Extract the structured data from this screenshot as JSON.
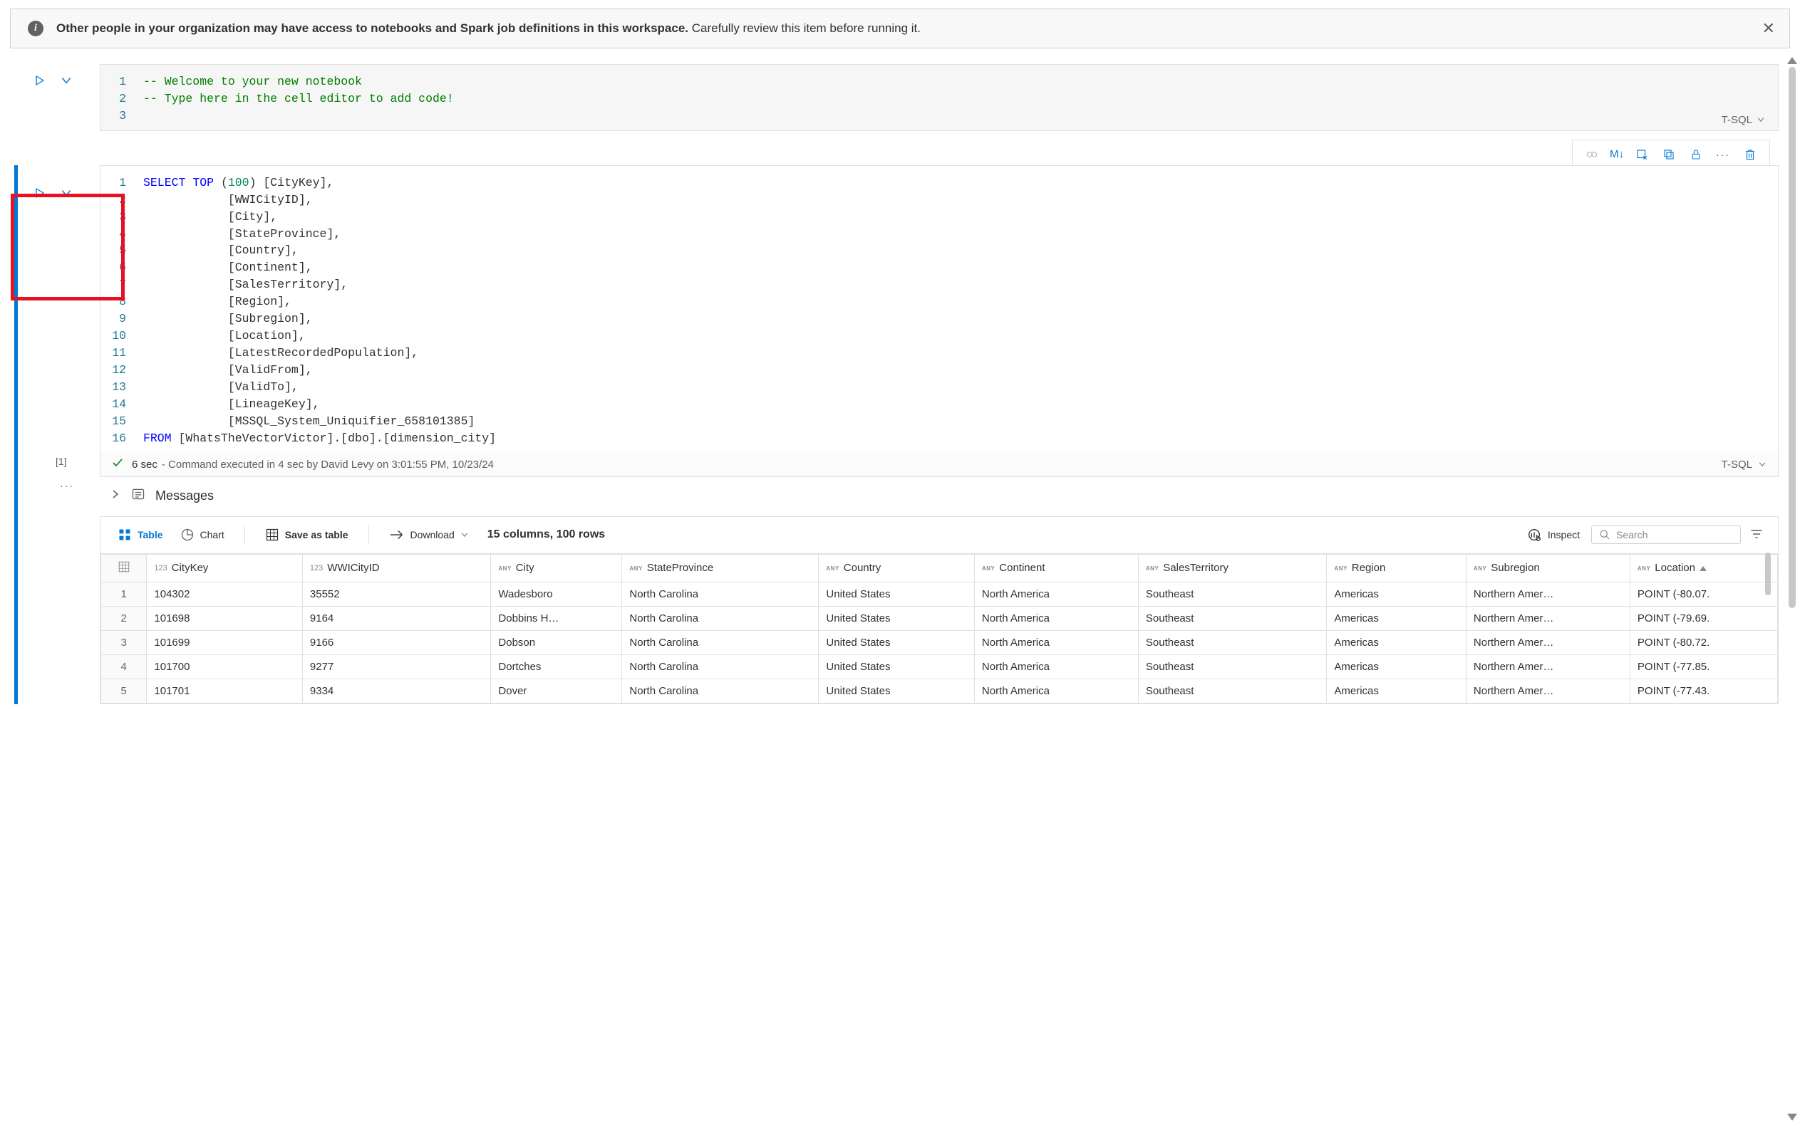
{
  "banner": {
    "bold": "Other people in your organization may have access to notebooks and Spark job definitions in this workspace.",
    "rest": " Carefully review this item before running it."
  },
  "cell1": {
    "lang": "T-SQL",
    "lines": [
      {
        "n": "1",
        "tokens": [
          {
            "t": "-- Welcome to your new notebook",
            "c": "tok-cmt"
          }
        ]
      },
      {
        "n": "2",
        "tokens": [
          {
            "t": "-- Type here in the cell editor to add code!",
            "c": "tok-cmt"
          }
        ]
      },
      {
        "n": "3",
        "tokens": [
          {
            "t": ""
          }
        ]
      }
    ]
  },
  "cell2": {
    "lang": "T-SQL",
    "idx_label": "[1]",
    "lines": [
      {
        "n": "1",
        "tokens": [
          {
            "t": "SELECT",
            "c": "tok-kw"
          },
          {
            "t": " "
          },
          {
            "t": "TOP",
            "c": "tok-kw"
          },
          {
            "t": " ("
          },
          {
            "t": "100",
            "c": "tok-num"
          },
          {
            "t": ") [CityKey],"
          }
        ]
      },
      {
        "n": "2",
        "tokens": [
          {
            "t": "            [WWICityID],"
          }
        ]
      },
      {
        "n": "3",
        "tokens": [
          {
            "t": "            [City],"
          }
        ]
      },
      {
        "n": "4",
        "tokens": [
          {
            "t": "            [StateProvince],"
          }
        ]
      },
      {
        "n": "5",
        "tokens": [
          {
            "t": "            [Country],"
          }
        ]
      },
      {
        "n": "6",
        "tokens": [
          {
            "t": "            [Continent],"
          }
        ]
      },
      {
        "n": "7",
        "tokens": [
          {
            "t": "            [SalesTerritory],"
          }
        ]
      },
      {
        "n": "8",
        "tokens": [
          {
            "t": "            [Region],"
          }
        ]
      },
      {
        "n": "9",
        "tokens": [
          {
            "t": "            [Subregion],"
          }
        ]
      },
      {
        "n": "10",
        "tokens": [
          {
            "t": "            [Location],"
          }
        ]
      },
      {
        "n": "11",
        "tokens": [
          {
            "t": "            [LatestRecordedPopulation],"
          }
        ]
      },
      {
        "n": "12",
        "tokens": [
          {
            "t": "            [ValidFrom],"
          }
        ]
      },
      {
        "n": "13",
        "tokens": [
          {
            "t": "            [ValidTo],"
          }
        ]
      },
      {
        "n": "14",
        "tokens": [
          {
            "t": "            [LineageKey],"
          }
        ]
      },
      {
        "n": "15",
        "tokens": [
          {
            "t": "            [MSSQL_System_Uniquifier_658101385]"
          }
        ]
      },
      {
        "n": "16",
        "tokens": [
          {
            "t": "FROM",
            "c": "tok-kw"
          },
          {
            "t": " [WhatsTheVectorVictor].[dbo].[dimension_city]"
          }
        ]
      }
    ],
    "status": {
      "duration": "6 sec",
      "detail": "- Command executed in 4 sec by David Levy on 3:01:55 PM, 10/23/24"
    },
    "toolbar_md": "M↓"
  },
  "messages_label": "Messages",
  "results": {
    "table_label": "Table",
    "chart_label": "Chart",
    "save_label": "Save as table",
    "download_label": "Download",
    "summary": "15 columns, 100 rows",
    "inspect_label": "Inspect",
    "search_placeholder": "Search",
    "columns": [
      {
        "type": "idx",
        "name": ""
      },
      {
        "type": "123",
        "name": "CityKey"
      },
      {
        "type": "123",
        "name": "WWICityID"
      },
      {
        "type": "ANY",
        "name": "City"
      },
      {
        "type": "ANY",
        "name": "StateProvince"
      },
      {
        "type": "ANY",
        "name": "Country"
      },
      {
        "type": "ANY",
        "name": "Continent"
      },
      {
        "type": "ANY",
        "name": "SalesTerritory"
      },
      {
        "type": "ANY",
        "name": "Region"
      },
      {
        "type": "ANY",
        "name": "Subregion"
      },
      {
        "type": "ANY",
        "name": "Location"
      }
    ],
    "rows": [
      {
        "n": "1",
        "CityKey": "104302",
        "WWICityID": "35552",
        "City": "Wadesboro",
        "StateProvince": "North Carolina",
        "Country": "United States",
        "Continent": "North America",
        "SalesTerritory": "Southeast",
        "Region": "Americas",
        "Subregion": "Northern Amer…",
        "Location": "POINT (-80.07."
      },
      {
        "n": "2",
        "CityKey": "101698",
        "WWICityID": "9164",
        "City": "Dobbins H…",
        "StateProvince": "North Carolina",
        "Country": "United States",
        "Continent": "North America",
        "SalesTerritory": "Southeast",
        "Region": "Americas",
        "Subregion": "Northern Amer…",
        "Location": "POINT (-79.69."
      },
      {
        "n": "3",
        "CityKey": "101699",
        "WWICityID": "9166",
        "City": "Dobson",
        "StateProvince": "North Carolina",
        "Country": "United States",
        "Continent": "North America",
        "SalesTerritory": "Southeast",
        "Region": "Americas",
        "Subregion": "Northern Amer…",
        "Location": "POINT (-80.72."
      },
      {
        "n": "4",
        "CityKey": "101700",
        "WWICityID": "9277",
        "City": "Dortches",
        "StateProvince": "North Carolina",
        "Country": "United States",
        "Continent": "North America",
        "SalesTerritory": "Southeast",
        "Region": "Americas",
        "Subregion": "Northern Amer…",
        "Location": "POINT (-77.85."
      },
      {
        "n": "5",
        "CityKey": "101701",
        "WWICityID": "9334",
        "City": "Dover",
        "StateProvince": "North Carolina",
        "Country": "United States",
        "Continent": "North America",
        "SalesTerritory": "Southeast",
        "Region": "Americas",
        "Subregion": "Northern Amer…",
        "Location": "POINT (-77.43."
      }
    ]
  }
}
